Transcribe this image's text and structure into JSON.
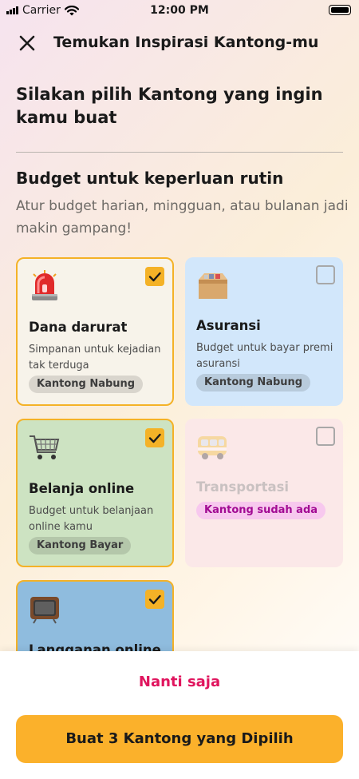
{
  "status_bar": {
    "carrier": "Carrier",
    "time": "12:00 PM"
  },
  "header": {
    "title": "Temukan Inspirasi Kantong-mu"
  },
  "heading": "Silakan pilih Kantong yang ingin kamu buat",
  "section": {
    "title": "Budget untuk keperluan rutin",
    "description": "Atur budget harian, mingguan, atau bulanan jadi makin gampang!"
  },
  "cards": [
    {
      "name": "dana-darurat",
      "icon": "siren-icon",
      "title": "Dana darurat",
      "description": "Simpanan untuk kejadian tak terduga",
      "badge": "Kantong Nabung",
      "selected": true,
      "background": "#f7f3ea"
    },
    {
      "name": "asuransi",
      "icon": "box-icon",
      "title": "Asuransi",
      "description": "Budget untuk bayar premi asuransi",
      "badge": "Kantong Nabung",
      "selected": false,
      "background": "#d2e7fb"
    },
    {
      "name": "belanja-online",
      "icon": "shopping-cart-icon",
      "title": "Belanja online",
      "description": "Budget untuk belanjaan online kamu",
      "badge": "Kantong Bayar",
      "selected": true,
      "background": "#cde3c2"
    },
    {
      "name": "transportasi",
      "icon": "bus-icon",
      "title": "Transportasi",
      "badge": "Kantong sudah ada",
      "selected": false,
      "disabled": true,
      "background": "#fbe8e8",
      "badge_color": "#a20b93",
      "badge_background": "#f7c8ee"
    },
    {
      "name": "langganan-online",
      "icon": "television-icon",
      "title": "Langganan online",
      "selected": true,
      "background": "#8fbcde"
    }
  ],
  "actions": {
    "later_label": "Nanti saja",
    "primary_label": "Buat 3 Kantong yang Dipilih"
  },
  "colors": {
    "accent": "#fbb12b",
    "link": "#e0155e",
    "check": "#f4b227"
  }
}
